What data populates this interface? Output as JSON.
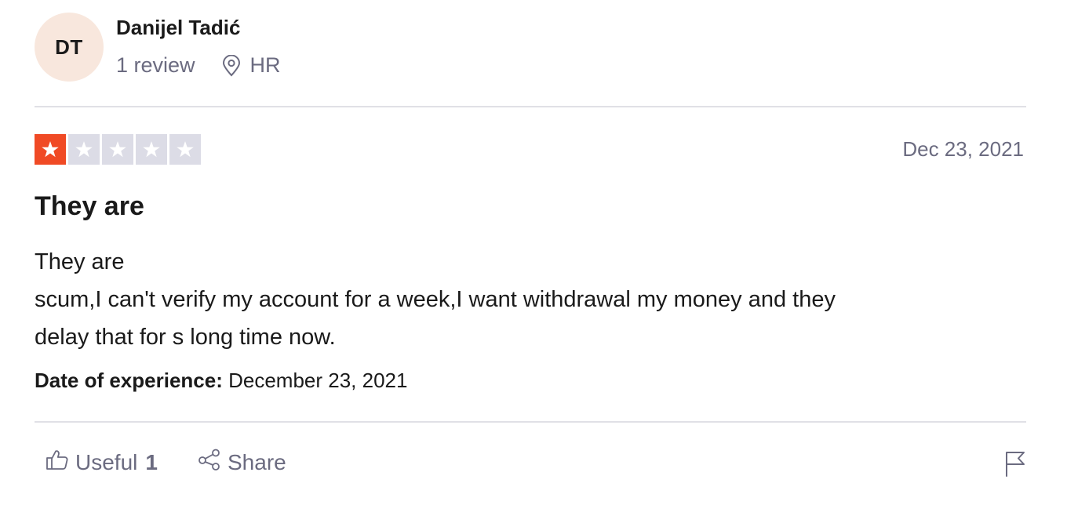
{
  "reviewer": {
    "initials": "DT",
    "name": "Danijel Tadić",
    "review_count": "1 review",
    "location": "HR",
    "avatar_color": "#f8e7dd"
  },
  "review": {
    "rating": 1,
    "rating_max": 5,
    "date": "Dec 23, 2021",
    "title": "They are",
    "body_lines": [
      "They are",
      "scum,I can't verify my account for a week,I want withdrawal my money and they",
      "delay that for s long time now."
    ],
    "experience_label": "Date of experience:",
    "experience_date": "December 23, 2021"
  },
  "actions": {
    "useful_label": "Useful",
    "useful_count": "1",
    "share_label": "Share"
  },
  "icons": {
    "location": "location-pin-icon",
    "star": "star-icon",
    "useful": "thumbs-up-icon",
    "share": "share-icon",
    "report": "flag-icon"
  },
  "colors": {
    "star_filled": "#f04a25",
    "star_empty": "#dcdce6",
    "muted_text": "#6b6b80"
  }
}
